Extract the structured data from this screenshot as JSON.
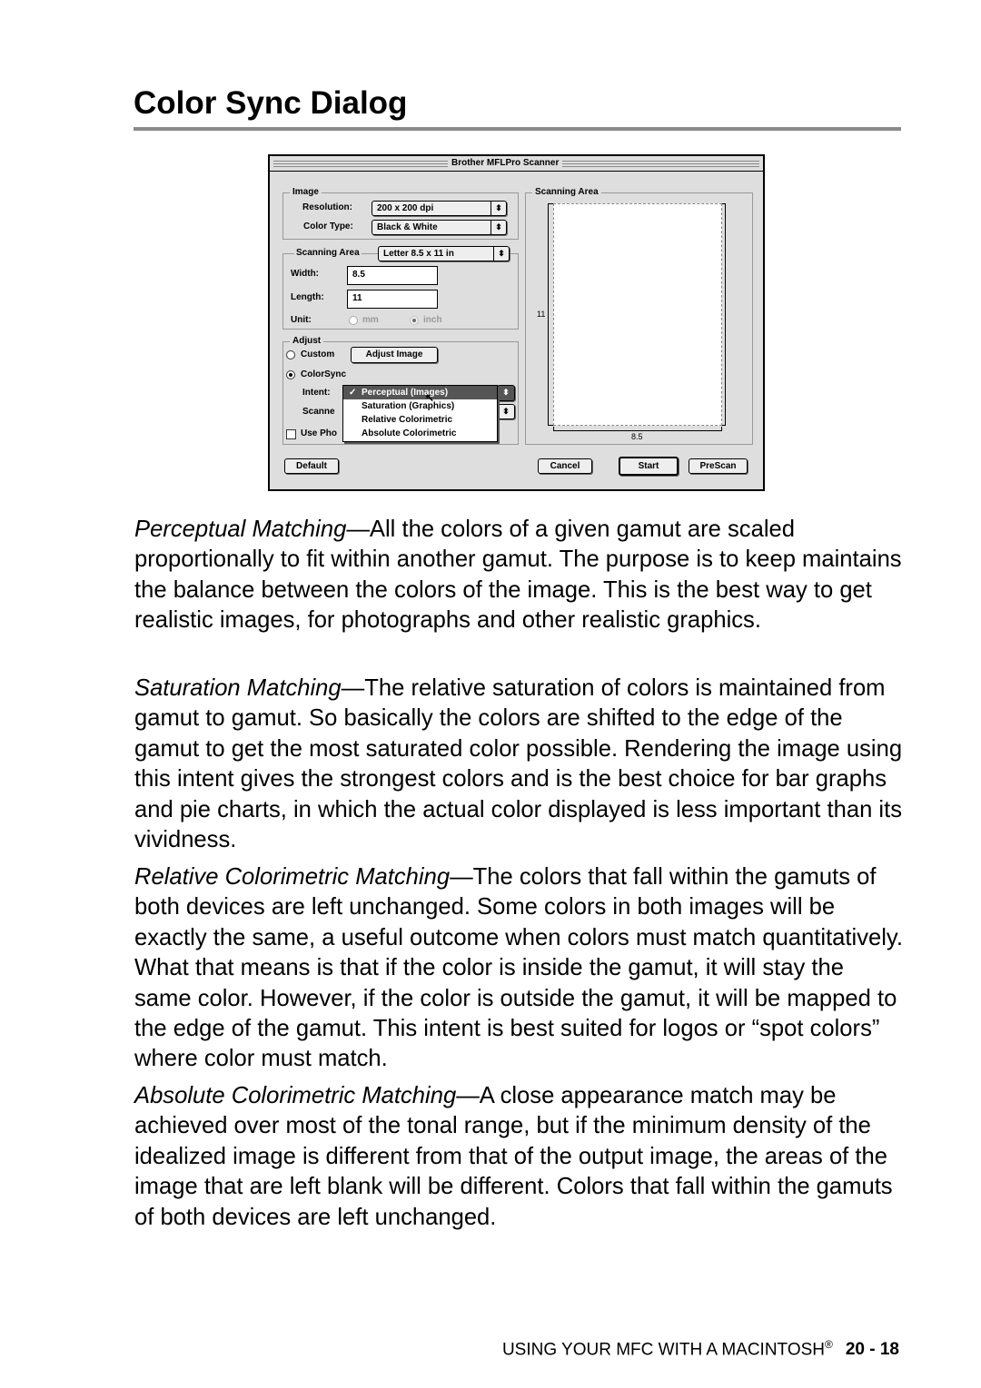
{
  "heading": "Color Sync Dialog",
  "dialog": {
    "title": "Brother MFLPro Scanner",
    "image_group": "Image",
    "resolution_label": "Resolution:",
    "resolution_value": "200 x 200 dpi",
    "color_type_label": "Color Type:",
    "color_type_value": "Black & White",
    "scanning_area_label": "Scanning Area",
    "scanning_area_value": "Letter 8.5 x 11 in",
    "width_label": "Width:",
    "width_value": "8.5",
    "length_label": "Length:",
    "length_value": "11",
    "unit_label": "Unit:",
    "unit_mm": "mm",
    "unit_inch": "inch",
    "unit_selected": "inch",
    "adjust_group": "Adjust",
    "custom_label": "Custom",
    "adjust_image_button": "Adjust Image",
    "colorsync_label": "ColorSync",
    "adjust_selected": "ColorSync",
    "intent_label": "Intent:",
    "intent_options": [
      "Perceptual (Images)",
      "Saturation (Graphics)",
      "Relative Colorimetric",
      "Absolute Colorimetric"
    ],
    "intent_selected": "Perceptual (Images)",
    "check_mark": "✓",
    "scanner_label": "Scanne",
    "use_photo_label": "Use Pho",
    "default_button": "Default",
    "preview_group": "Scanning Area",
    "preview_height_label": "11",
    "preview_width_label": "8.5",
    "cancel_button": "Cancel",
    "start_button": "Start",
    "prescan_button": "PreScan",
    "popup_arrow": "⬍"
  },
  "paragraphs": [
    {
      "term": "Perceptual Matching",
      "dash": "—",
      "text": "All the colors of a given gamut are scaled proportionally to fit within another gamut. The purpose is to keep maintains the balance between the colors of the image. This is the best way to get realistic images, for photographs and other realistic graphics."
    },
    {
      "term": "Saturation Matching",
      "dash": "—",
      "text": "The relative saturation of colors is maintained from gamut to gamut. So basically the colors are shifted to the edge of the gamut to get the most saturated color possible. Rendering the image using this intent gives the strongest colors and is the best choice for bar graphs and pie charts, in which the actual color displayed is less important than its vividness."
    },
    {
      "term": "Relative Colorimetric Matching",
      "dash": "—",
      "text": "The colors that fall within the gamuts of both devices are left unchanged. Some colors in both images will be exactly the same, a useful outcome when colors must match quantitatively. What that means is that if the color is inside the gamut, it will stay the same color. However, if the color is outside the gamut, it will be mapped to the edge of the gamut. This intent is best suited for logos or “spot colors” where color must match."
    },
    {
      "term": "Absolute Colorimetric Matching",
      "dash": "—",
      "text": "A close appearance match may be achieved over most of the tonal range, but if the minimum density of the idealized image is different from that of the output image, the areas of the image that are left blank will be different. Colors that fall within the gamuts of both devices are left unchanged."
    }
  ],
  "footer": {
    "section": "USING YOUR MFC WITH A MACINTOSH",
    "reg": "®",
    "page": "20 - 18"
  }
}
